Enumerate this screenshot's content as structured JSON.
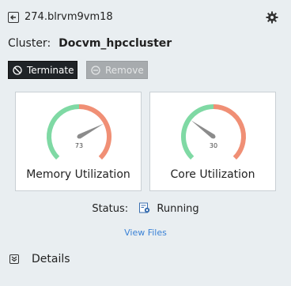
{
  "header": {
    "vm_name": "274.blrvm9vm18"
  },
  "cluster": {
    "label": "Cluster:",
    "name": "Docvm_hpccluster"
  },
  "actions": {
    "terminate_label": "Terminate",
    "remove_label": "Remove"
  },
  "gauges": [
    {
      "label": "Memory Utilization",
      "value": 73,
      "value_text": "73"
    },
    {
      "label": "Core Utilization",
      "value": 30,
      "value_text": "30"
    }
  ],
  "status": {
    "label": "Status:",
    "value": "Running"
  },
  "links": {
    "view_files": "View Files"
  },
  "details": {
    "label": "Details"
  },
  "colors": {
    "gauge_low": "#7fd9a4",
    "gauge_high": "#f08f75",
    "needle": "#8b8b8b",
    "link": "#3b82d6",
    "terminate_bg": "#1f2327",
    "remove_bg": "#a7abae"
  }
}
